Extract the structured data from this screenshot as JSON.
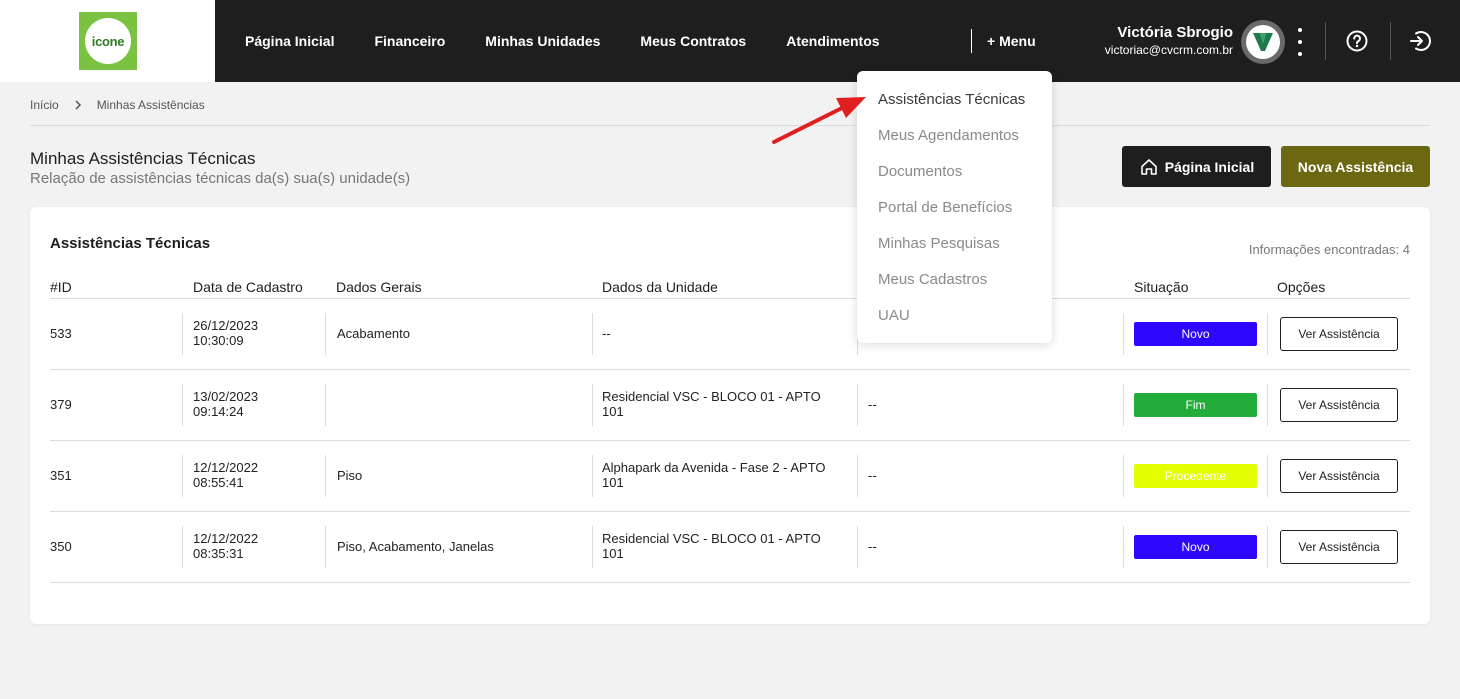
{
  "brand": {
    "logo_text": "icone",
    "accent": "#7cc242"
  },
  "nav": {
    "items": [
      "Página Inicial",
      "Financeiro",
      "Minhas Unidades",
      "Meus Contratos",
      "Atendimentos"
    ],
    "more": "+ Menu"
  },
  "user": {
    "name": "Victória Sbrogio",
    "email": "victoriac@cvcrm.com.br",
    "avatar_icon": "v-logo-icon"
  },
  "header_icons": [
    "more-vertical-icon",
    "help-icon",
    "logout-icon"
  ],
  "breadcrumb": {
    "home": "Início",
    "current": "Minhas Assistências"
  },
  "page": {
    "title": "Minhas Assistências Técnicas",
    "subtitle": "Relação de assistências técnicas da(s) sua(s) unidade(s)"
  },
  "actions": {
    "home_label": "Página Inicial",
    "new_label": "Nova Assistência"
  },
  "table": {
    "title": "Assistências Técnicas",
    "found": "Informações encontradas: 4",
    "columns": {
      "id": "#ID",
      "date": "Data de Cadastro",
      "general": "Dados Gerais",
      "unit": "Dados da Unidade",
      "status": "Situação",
      "options": "Opções"
    },
    "rows": [
      {
        "id": "533",
        "date": "26/12/2023",
        "time": "10:30:09",
        "general": "Acabamento",
        "unit1": "--",
        "unit2": "",
        "extra": "",
        "status": "Novo",
        "status_color": "#2e07ff",
        "action": "Ver Assistência"
      },
      {
        "id": "379",
        "date": "13/02/2023",
        "time": "09:14:24",
        "general": "",
        "unit1": "Residencial VSC - BLOCO 01 - APTO",
        "unit2": "101",
        "extra": "--",
        "status": "Fim",
        "status_color": "#22ac3a",
        "action": "Ver Assistência"
      },
      {
        "id": "351",
        "date": "12/12/2022",
        "time": "08:55:41",
        "general": "Piso",
        "unit1": "Alphapark da Avenida - Fase 2 - APTO",
        "unit2": "101",
        "extra": "--",
        "status": "Procedente",
        "status_color": "#e4ff00",
        "action": "Ver Assistência"
      },
      {
        "id": "350",
        "date": "12/12/2022",
        "time": "08:35:31",
        "general": "Piso, Acabamento, Janelas",
        "unit1": "Residencial VSC - BLOCO 01 - APTO",
        "unit2": "101",
        "extra": "--",
        "status": "Novo",
        "status_color": "#2e07ff",
        "action": "Ver Assistência"
      }
    ]
  },
  "menu_dropdown": {
    "items": [
      "Assistências Técnicas",
      "Meus Agendamentos",
      "Documentos",
      "Portal de Benefícios",
      "Minhas Pesquisas",
      "Meus Cadastros",
      "UAU"
    ],
    "active": "Assistências Técnicas"
  },
  "annotation_color": "#e02020"
}
